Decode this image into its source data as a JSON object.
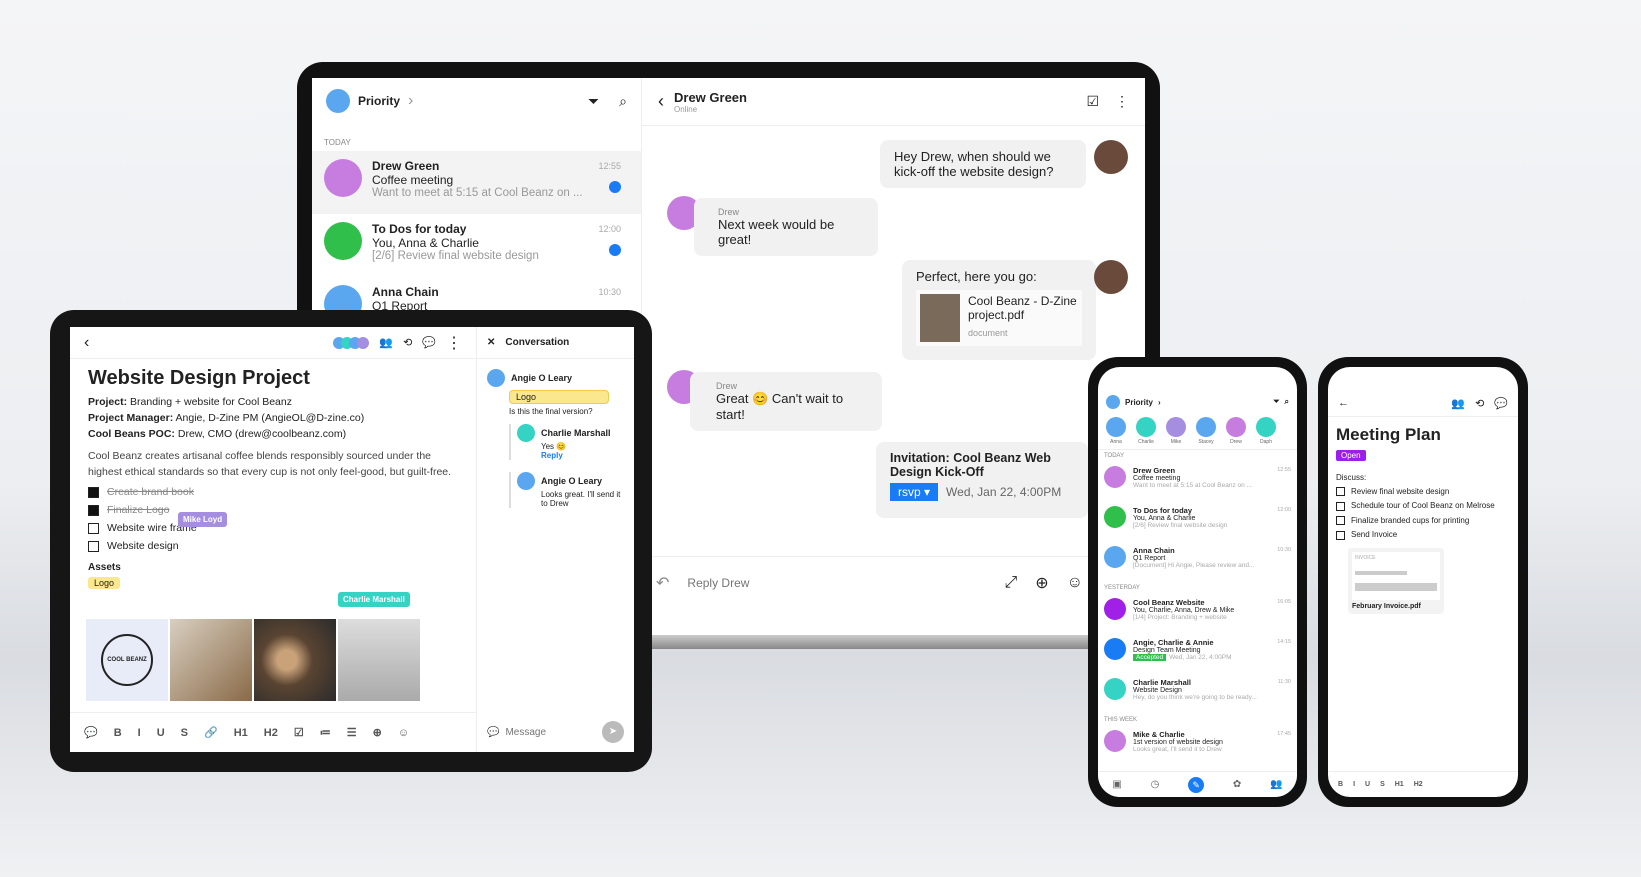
{
  "laptop": {
    "sidebar": {
      "title": "Priority",
      "section": "TODAY",
      "items": [
        {
          "name": "Drew Green",
          "subject": "Coffee meeting",
          "preview": "Want to meet at 5:15 at Cool Beanz on ...",
          "time": "12:55",
          "unread": true,
          "color": "#c77de0"
        },
        {
          "name": "To Dos for today",
          "subject": "You, Anna & Charlie",
          "preview": "[2/6] Review final website design",
          "time": "12:00",
          "unread": true,
          "color": "#2fbf4a"
        },
        {
          "name": "Anna Chain",
          "subject": "Q1 Report",
          "preview": "",
          "time": "10:30",
          "unread": false,
          "color": "#5aa7f0"
        }
      ]
    },
    "chat": {
      "contact": "Drew Green",
      "status": "Online",
      "messages": [
        {
          "text": "Hey Drew, when should we kick-off the website design?"
        },
        {
          "sender": "Drew",
          "text": "Next week would be great!"
        },
        {
          "text": "Perfect, here you go:",
          "file": "Cool Beanz - D-Zine project.pdf",
          "file_type": "document"
        },
        {
          "sender": "Drew",
          "text": "Great 😊 Can't wait to start!"
        },
        {
          "invite": "Invitation: Cool Beanz Web Design Kick-Off",
          "rsvp": "rsvp",
          "date": "Wed, Jan 22, 4:00PM"
        }
      ],
      "reply_placeholder": "Reply Drew"
    }
  },
  "tablet": {
    "title": "Website Design Project",
    "fields": [
      {
        "label": "Project:",
        "value": "Branding + website for Cool Beanz"
      },
      {
        "label": "Project Manager:",
        "value": "Angie, D-Zine PM (AngieOL@D-zine.co)"
      },
      {
        "label": "Cool Beans POC:",
        "value": "Drew, CMO (drew@coolbeanz.com)"
      }
    ],
    "description": "Cool Beanz creates artisanal coffee blends responsibly sourced under the highest ethical standards so that every cup is not only feel-good, but guilt-free.",
    "tasks": [
      {
        "label": "Create brand book",
        "done": true
      },
      {
        "label": "Finalize Logo",
        "done": true
      },
      {
        "label": "Website wire frame",
        "done": false
      },
      {
        "label": "Website design",
        "done": false
      }
    ],
    "cursor_tags": [
      "Mike Loyd",
      "Charlie Marshall"
    ],
    "assets_label": "Assets",
    "asset_tag": "Logo",
    "logo_text": "COOL BEANZ",
    "toolbar": [
      "B",
      "I",
      "U",
      "S",
      "H1",
      "H2"
    ],
    "conversation": {
      "title": "Conversation",
      "comments": [
        {
          "author": "Angie O Leary",
          "tag": "Logo",
          "text": "Is this the final version?"
        },
        {
          "author": "Charlie Marshall",
          "text": "Yes 😊",
          "reply": "Reply"
        },
        {
          "author": "Angie O Leary",
          "text": "Looks great. I'll send it to Drew"
        }
      ],
      "message_placeholder": "Message"
    }
  },
  "phone1": {
    "title": "Priority",
    "contacts": [
      "Anna",
      "Charlie",
      "Mike",
      "Stacey",
      "Drew",
      "Daph"
    ],
    "sections": [
      {
        "label": "TODAY",
        "items": [
          {
            "name": "Drew Green",
            "subject": "Coffee meeting",
            "preview": "Want to meet at 5:15 at Cool Beanz on ...",
            "time": "12:55",
            "color": "#c77de0"
          },
          {
            "name": "To Dos for today",
            "subject": "You, Anna & Charlie",
            "preview": "[2/6] Review final website design",
            "time": "12:00",
            "color": "#2fbf4a"
          },
          {
            "name": "Anna Chain",
            "subject": "Q1 Report",
            "preview": "[Document] Hi Angie, Please review and...",
            "time": "10:30",
            "color": "#5aa7f0"
          }
        ]
      },
      {
        "label": "YESTERDAY",
        "items": [
          {
            "name": "Cool Beanz Website",
            "subject": "You, Charlie, Anna, Drew & Mike",
            "preview": "[1/4] Project: Branding + website",
            "time": "16:05",
            "color": "#a020e8"
          },
          {
            "name": "Angie, Charlie & Annie",
            "subject": "Design Team Meeting",
            "preview": "Wed, Jan 22, 4:00PM",
            "badge": "Accepted",
            "time": "14:15",
            "color": "#1a7cf5"
          },
          {
            "name": "Charlie Marshall",
            "subject": "Website Design",
            "preview": "Hey, do you think we're going to be ready...",
            "time": "11:30",
            "color": "#34d3c4"
          }
        ]
      },
      {
        "label": "THIS WEEK",
        "items": [
          {
            "name": "Mike & Charlie",
            "subject": "1st version of website design",
            "preview": "Looks great, I'll send it to Drew",
            "time": "17:45",
            "color": "#c77de0"
          }
        ]
      }
    ]
  },
  "phone2": {
    "title": "Meeting Plan",
    "status": "Open",
    "status_color": "#9b1fe8",
    "discuss": "Discuss:",
    "tasks": [
      "Review final website design",
      "Schedule tour of Cool Beanz on Melrose",
      "Finalize branded cups for printing",
      "Send Invoice"
    ],
    "attachment": {
      "name": "February Invoice.pdf",
      "label": "INVOICE"
    },
    "toolbar": [
      "B",
      "I",
      "U",
      "S",
      "H1",
      "H2"
    ]
  },
  "colors": {
    "accent": "#1a7cf5",
    "online": "#2fbf4a"
  }
}
